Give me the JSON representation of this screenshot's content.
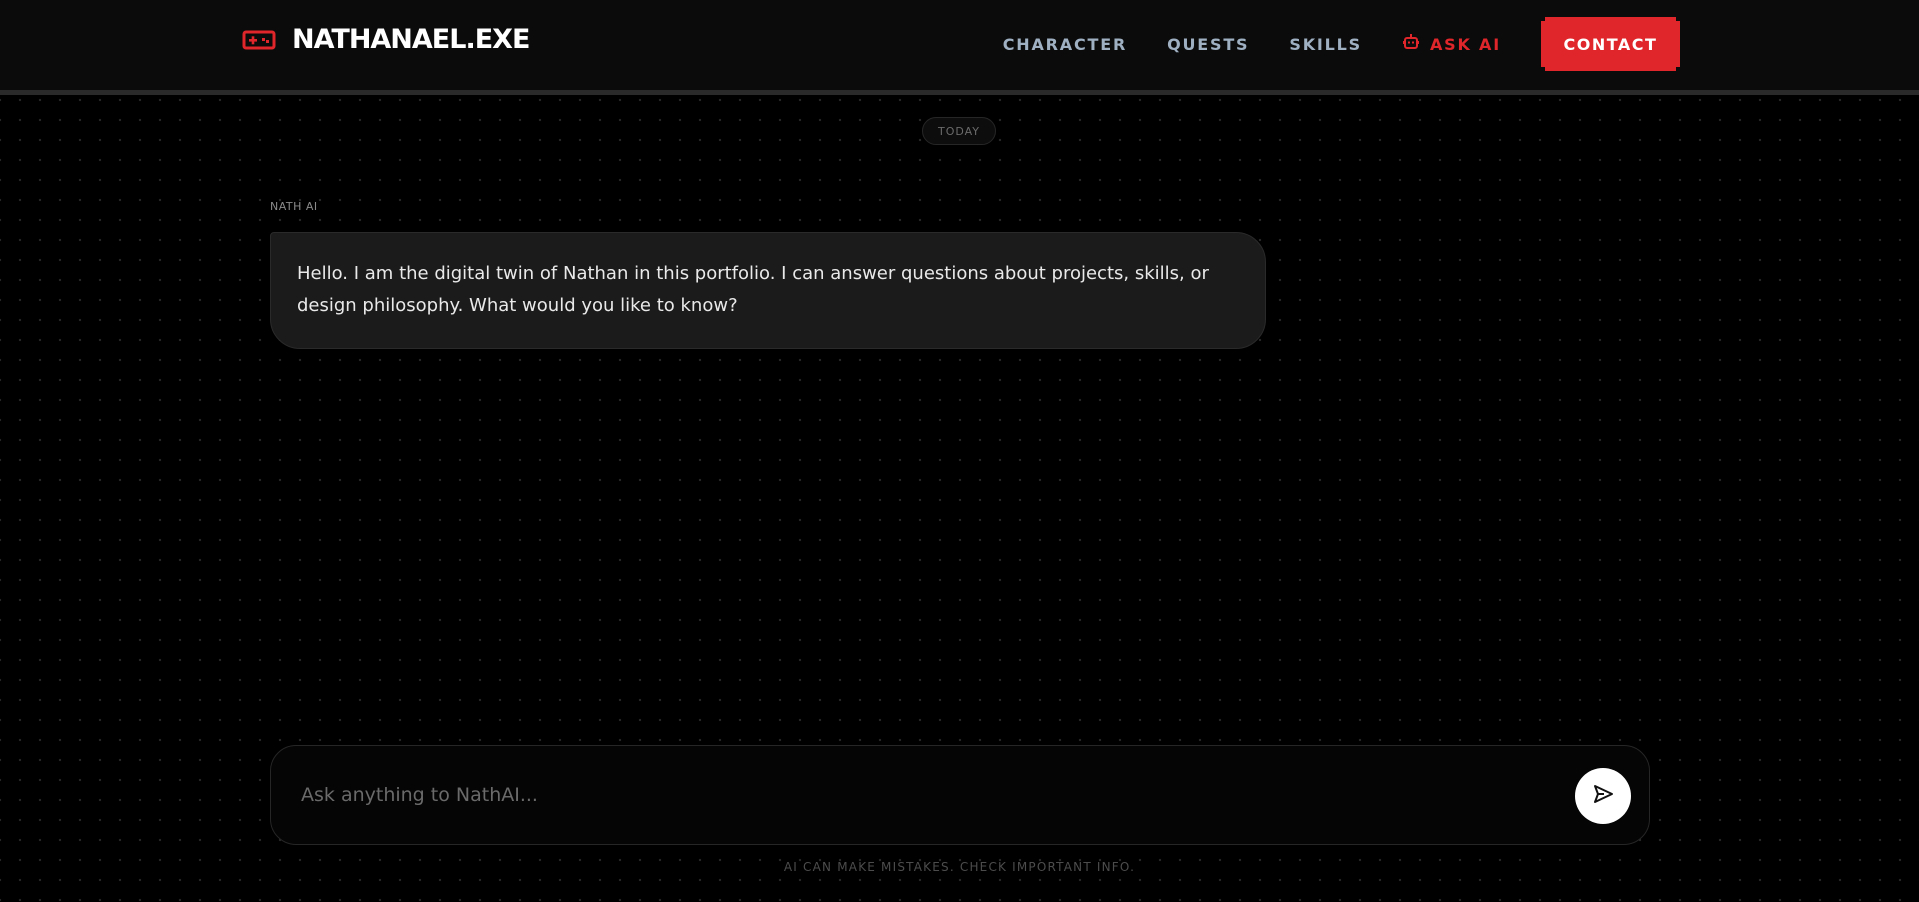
{
  "header": {
    "brand_icon": "gamepad-icon",
    "brand_title": "NATHANAEL.EXE",
    "nav": [
      {
        "label": "CHARACTER"
      },
      {
        "label": "QUESTS"
      },
      {
        "label": "SKILLS"
      },
      {
        "label": "ASK AI",
        "icon": "robot-icon"
      }
    ],
    "contact_label": "CONTACT"
  },
  "chat": {
    "date_divider": "TODAY",
    "messages": [
      {
        "sender": "NATH AI",
        "text": "Hello. I am the digital twin of Nathan in this portfolio. I can answer questions about projects, skills, or design philosophy. What would you like to know?"
      }
    ]
  },
  "composer": {
    "placeholder": "Ask anything to NathAI...",
    "value": "",
    "send_icon": "send-icon"
  },
  "footer": {
    "disclaimer": "AI CAN MAKE MISTAKES. CHECK IMPORTANT INFO."
  },
  "colors": {
    "accent": "#e0262a",
    "background": "#000000",
    "header": "#0b0b0b",
    "bubble": "#1b1b1b",
    "nav_text": "#9fb0c2"
  }
}
